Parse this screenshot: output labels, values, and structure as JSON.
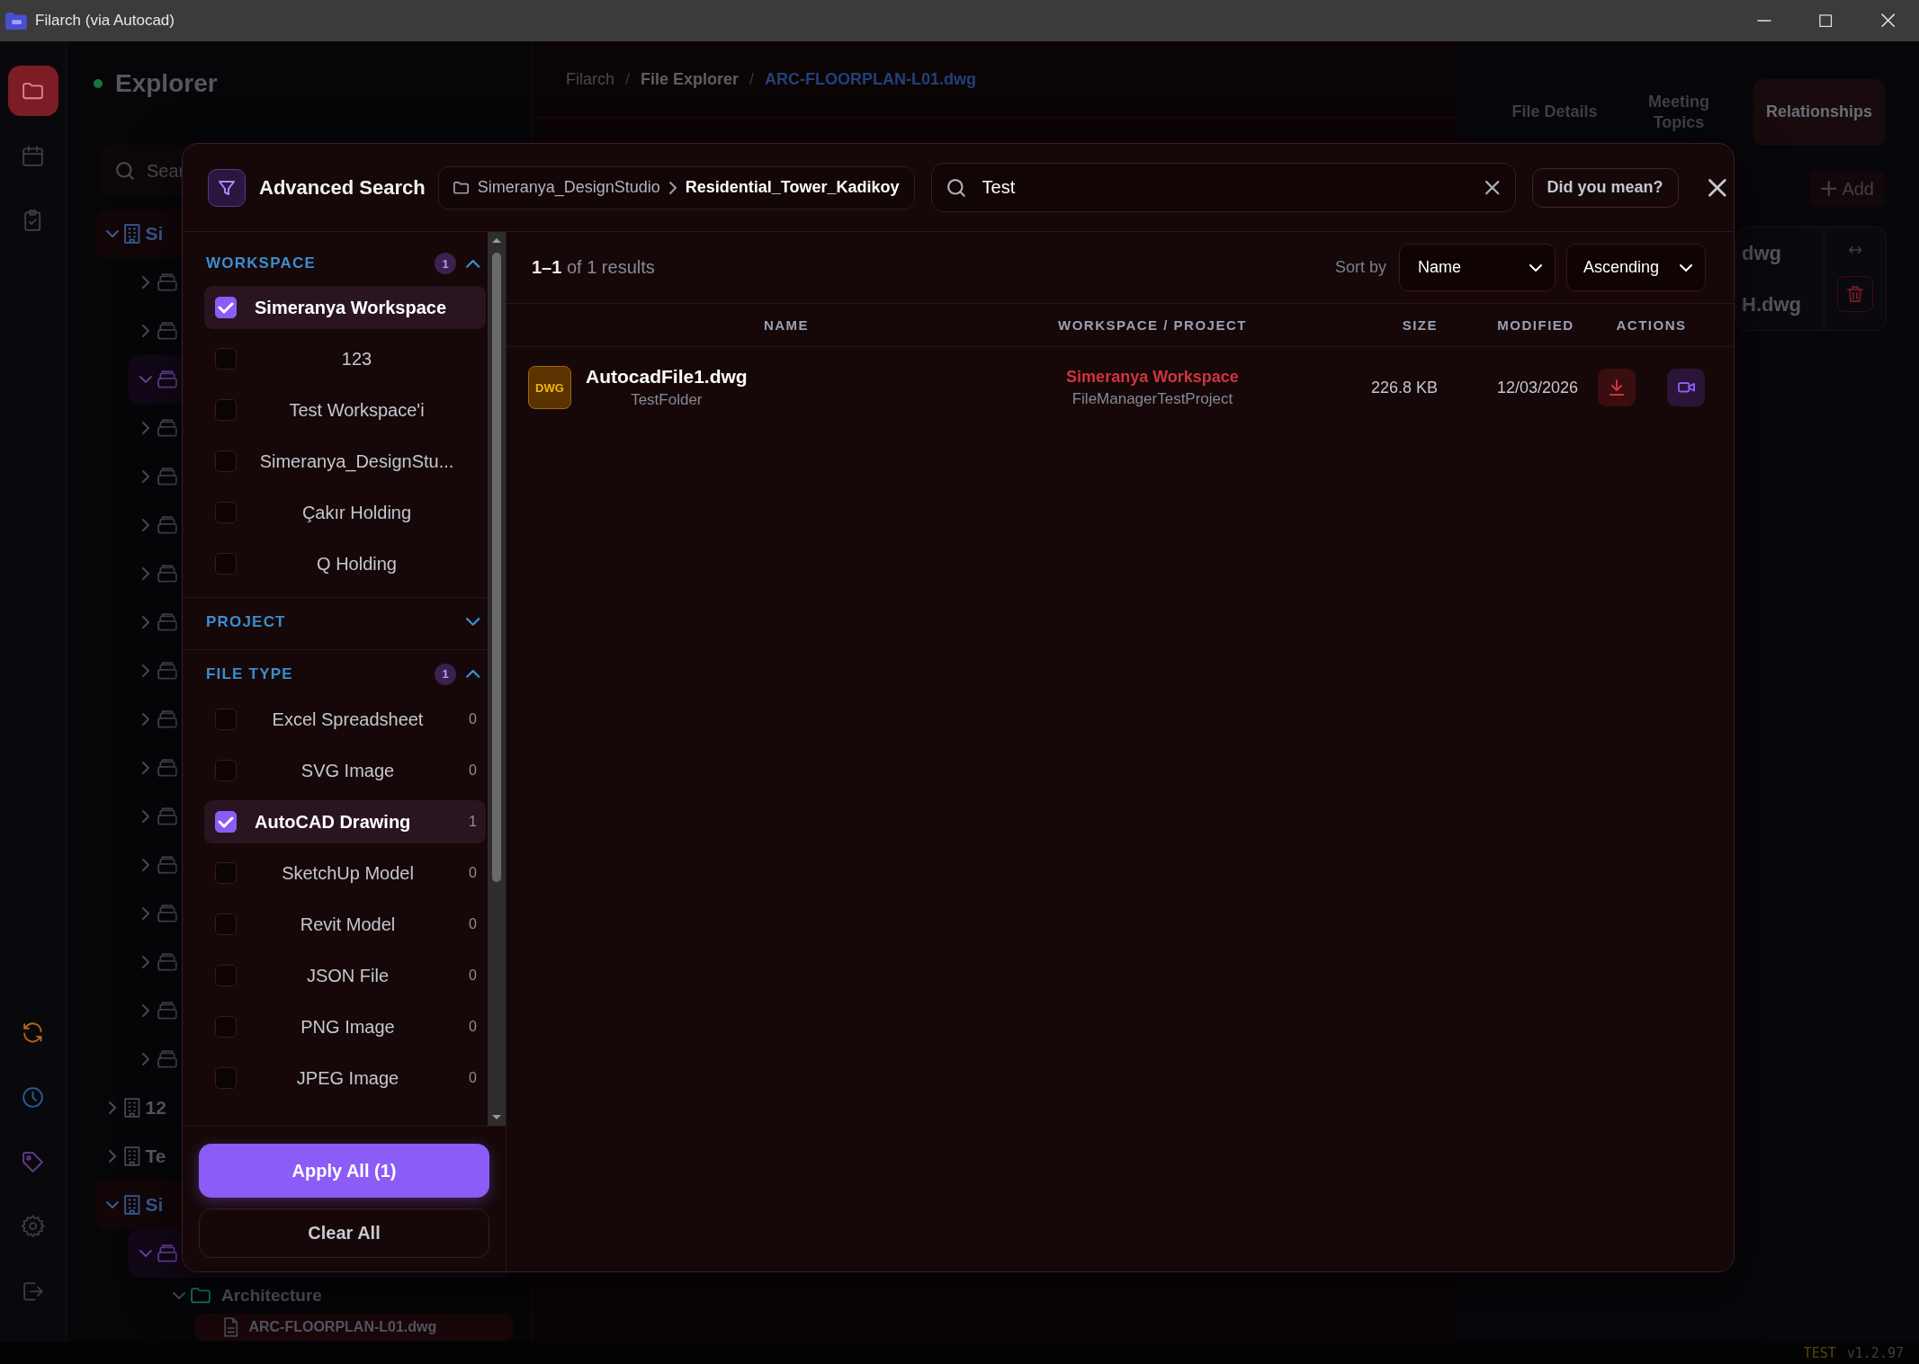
{
  "window": {
    "title": "Filarch (via Autocad)"
  },
  "rail": {
    "top": [
      {
        "kind": "folder",
        "selected": true
      },
      {
        "kind": "calendar",
        "selected": false
      },
      {
        "kind": "clipboard",
        "selected": false
      }
    ],
    "bottom": [
      {
        "kind": "sync",
        "selected": false
      },
      {
        "kind": "clock",
        "selected": false
      },
      {
        "kind": "tag",
        "selected": false
      },
      {
        "kind": "gear",
        "selected": false
      },
      {
        "kind": "logout",
        "selected": false
      }
    ]
  },
  "explorer": {
    "title": "Explorer",
    "search": {
      "placeholder": "Sear"
    },
    "tree": [
      {
        "kind": "workspace",
        "label": "Si",
        "expanded": true,
        "children": [
          {
            "kind": "project",
            "expanded": false
          },
          {
            "kind": "project",
            "expanded": false
          },
          {
            "kind": "project",
            "expanded": true
          },
          {
            "kind": "project",
            "expanded": false
          },
          {
            "kind": "project",
            "expanded": false
          },
          {
            "kind": "project",
            "expanded": false
          },
          {
            "kind": "project",
            "expanded": false
          },
          {
            "kind": "project",
            "expanded": false
          },
          {
            "kind": "project",
            "expanded": false
          },
          {
            "kind": "project",
            "expanded": false
          },
          {
            "kind": "project",
            "expanded": false
          },
          {
            "kind": "project",
            "expanded": false
          },
          {
            "kind": "project",
            "expanded": false
          },
          {
            "kind": "project",
            "expanded": false
          },
          {
            "kind": "project",
            "expanded": false
          },
          {
            "kind": "project",
            "expanded": false
          },
          {
            "kind": "project",
            "expanded": false
          }
        ]
      },
      {
        "kind": "workspace",
        "label": "12",
        "expanded": false
      },
      {
        "kind": "workspace",
        "label": "Te",
        "expanded": false
      },
      {
        "kind": "workspace",
        "label": "Si",
        "expanded": true,
        "children": [
          {
            "kind": "project",
            "expanded": true,
            "children": [
              {
                "kind": "folder",
                "label": "Architecture",
                "expanded": true,
                "children": [
                  {
                    "kind": "file",
                    "label": "ARC-FLOORPLAN-L01.dwg",
                    "selected": true
                  }
                ]
              }
            ]
          }
        ]
      }
    ]
  },
  "breadcrumb": {
    "separator": "/",
    "items": [
      {
        "label": "Filarch",
        "current": false
      },
      {
        "label": "File Explorer",
        "current": false
      },
      {
        "label": "ARC-FLOORPLAN-L01.dwg",
        "current": true
      }
    ]
  },
  "details_panel": {
    "tabs": [
      {
        "label": "File Details",
        "selected": false
      },
      {
        "label": "Meeting Topics",
        "selected": false
      },
      {
        "label": "Relationships",
        "selected": true
      }
    ],
    "add_button": "Add",
    "relations": [
      "dwg",
      "H.dwg"
    ]
  },
  "search_modal": {
    "title": "Advanced Search",
    "path": [
      "Simeranya_DesignStudio",
      "Residential_Tower_Kadikoy"
    ],
    "query": "Test",
    "suggest_button": "Did you mean?",
    "filters": [
      {
        "title": "WORKSPACE",
        "count": "1",
        "expanded": true,
        "items": [
          {
            "label": "Simeranya Workspace",
            "checked": true
          },
          {
            "label": "123",
            "checked": false
          },
          {
            "label": "Test Workspace'i",
            "checked": false
          },
          {
            "label": "Simeranya_DesignStu...",
            "checked": false
          },
          {
            "label": "Çakır Holding",
            "checked": false
          },
          {
            "label": "Q Holding",
            "checked": false
          }
        ]
      },
      {
        "title": "PROJECT",
        "expanded": false
      },
      {
        "title": "FILE TYPE",
        "count": "1",
        "expanded": true,
        "items": [
          {
            "label": "Excel Spreadsheet",
            "count": "0",
            "checked": false
          },
          {
            "label": "SVG Image",
            "count": "0",
            "checked": false
          },
          {
            "label": "AutoCAD Drawing",
            "count": "1",
            "checked": true
          },
          {
            "label": "SketchUp Model",
            "count": "0",
            "checked": false
          },
          {
            "label": "Revit Model",
            "count": "0",
            "checked": false
          },
          {
            "label": "JSON File",
            "count": "0",
            "checked": false
          },
          {
            "label": "PNG Image",
            "count": "0",
            "checked": false
          },
          {
            "label": "JPEG Image",
            "count": "0",
            "checked": false
          }
        ]
      }
    ],
    "apply_button": "Apply All (1)",
    "clear_button": "Clear All",
    "results": {
      "range": "1–1",
      "summary": "of 1 results",
      "sort_label": "Sort by",
      "sort_field": "Name",
      "sort_order": "Ascending",
      "columns": [
        "NAME",
        "WORKSPACE / PROJECT",
        "SIZE",
        "MODIFIED",
        "ACTIONS"
      ],
      "rows": [
        {
          "badge": "DWG",
          "name": "AutocadFile1.dwg",
          "folder": "TestFolder",
          "workspace": "Simeranya Workspace",
          "project": "FileManagerTestProject",
          "size": "226.8 KB",
          "modified": "12/03/2026"
        }
      ]
    }
  },
  "status_bar": {
    "environment": "TEST",
    "version": "v1.2.97"
  }
}
